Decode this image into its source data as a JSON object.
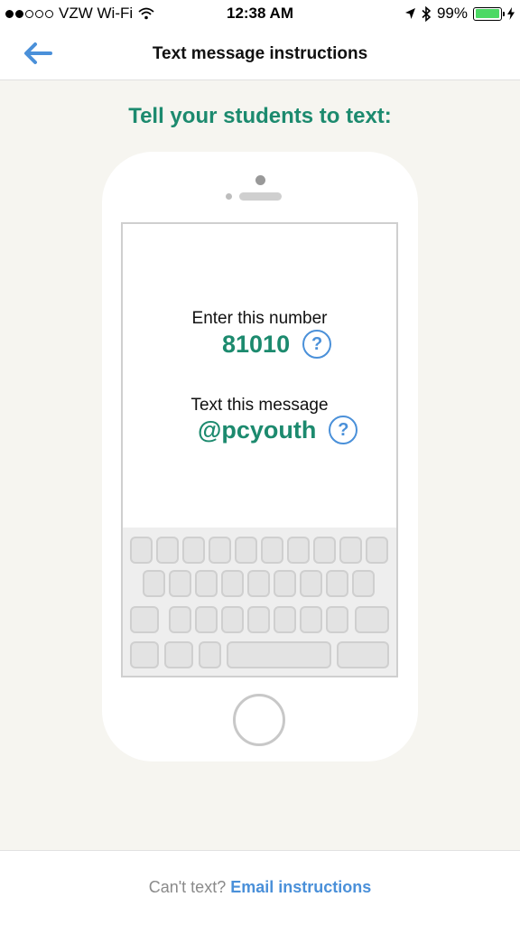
{
  "status_bar": {
    "carrier": "VZW Wi-Fi",
    "time": "12:38 AM",
    "battery": "99%",
    "battery_level": 0.99,
    "icons": [
      "signal-dots-icon",
      "wifi-icon",
      "location-arrow-icon",
      "bluetooth-icon",
      "battery-icon",
      "charging-bolt-icon"
    ]
  },
  "nav": {
    "title": "Text message instructions",
    "back_icon": "arrow-left-icon"
  },
  "headline": "Tell your students to text:",
  "instructions": {
    "number_label": "Enter this number",
    "number_value": "81010",
    "message_label": "Text this message",
    "message_value": "@pcyouth",
    "help_glyph": "?"
  },
  "footer": {
    "prefix": "Can't text?",
    "link": "Email instructions"
  },
  "colors": {
    "accent_green": "#1c8a6e",
    "link_blue": "#4a90d9",
    "background": "#f6f5f0"
  }
}
